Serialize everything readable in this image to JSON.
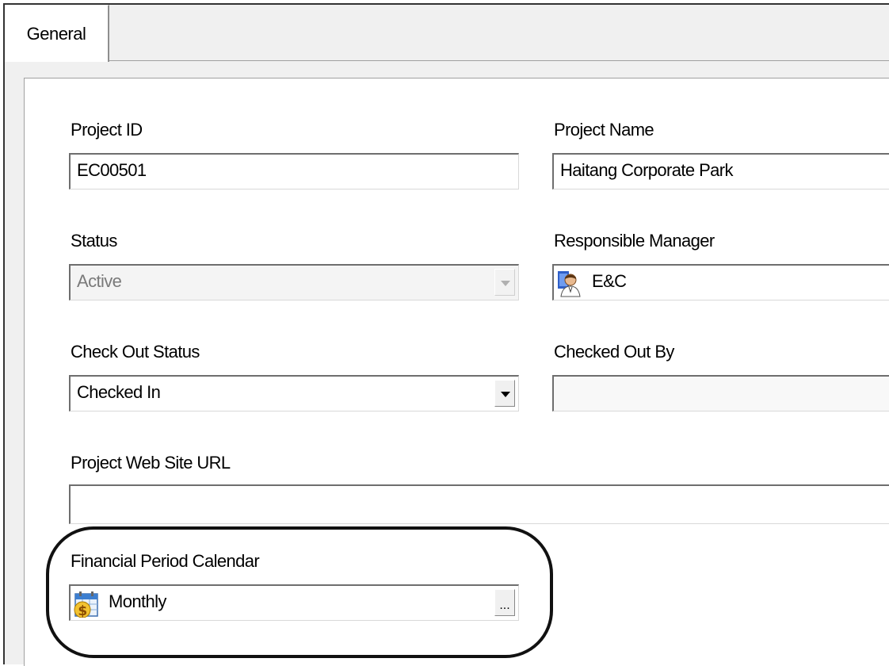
{
  "tabs": [
    {
      "label": "General",
      "active": true
    }
  ],
  "fields": {
    "project_id": {
      "label": "Project ID",
      "value": "EC00501"
    },
    "project_name": {
      "label": "Project Name",
      "value": "Haitang Corporate Park"
    },
    "status": {
      "label": "Status",
      "value": "Active",
      "disabled": true
    },
    "responsible_manager": {
      "label": "Responsible Manager",
      "value": "E&C",
      "icon": "person-icon"
    },
    "check_out_status": {
      "label": "Check Out Status",
      "value": "Checked In"
    },
    "checked_out_by": {
      "label": "Checked Out By",
      "value": ""
    },
    "project_web_site_url": {
      "label": "Project Web Site URL",
      "value": ""
    },
    "financial_period_calendar": {
      "label": "Financial Period Calendar",
      "value": "Monthly",
      "icon": "calendar-dollar-icon",
      "button_label": "..."
    }
  },
  "colors": {
    "panel_bg": "#ffffff",
    "frame_bg": "#f0f0f0",
    "highlight_ring": "#111111"
  }
}
